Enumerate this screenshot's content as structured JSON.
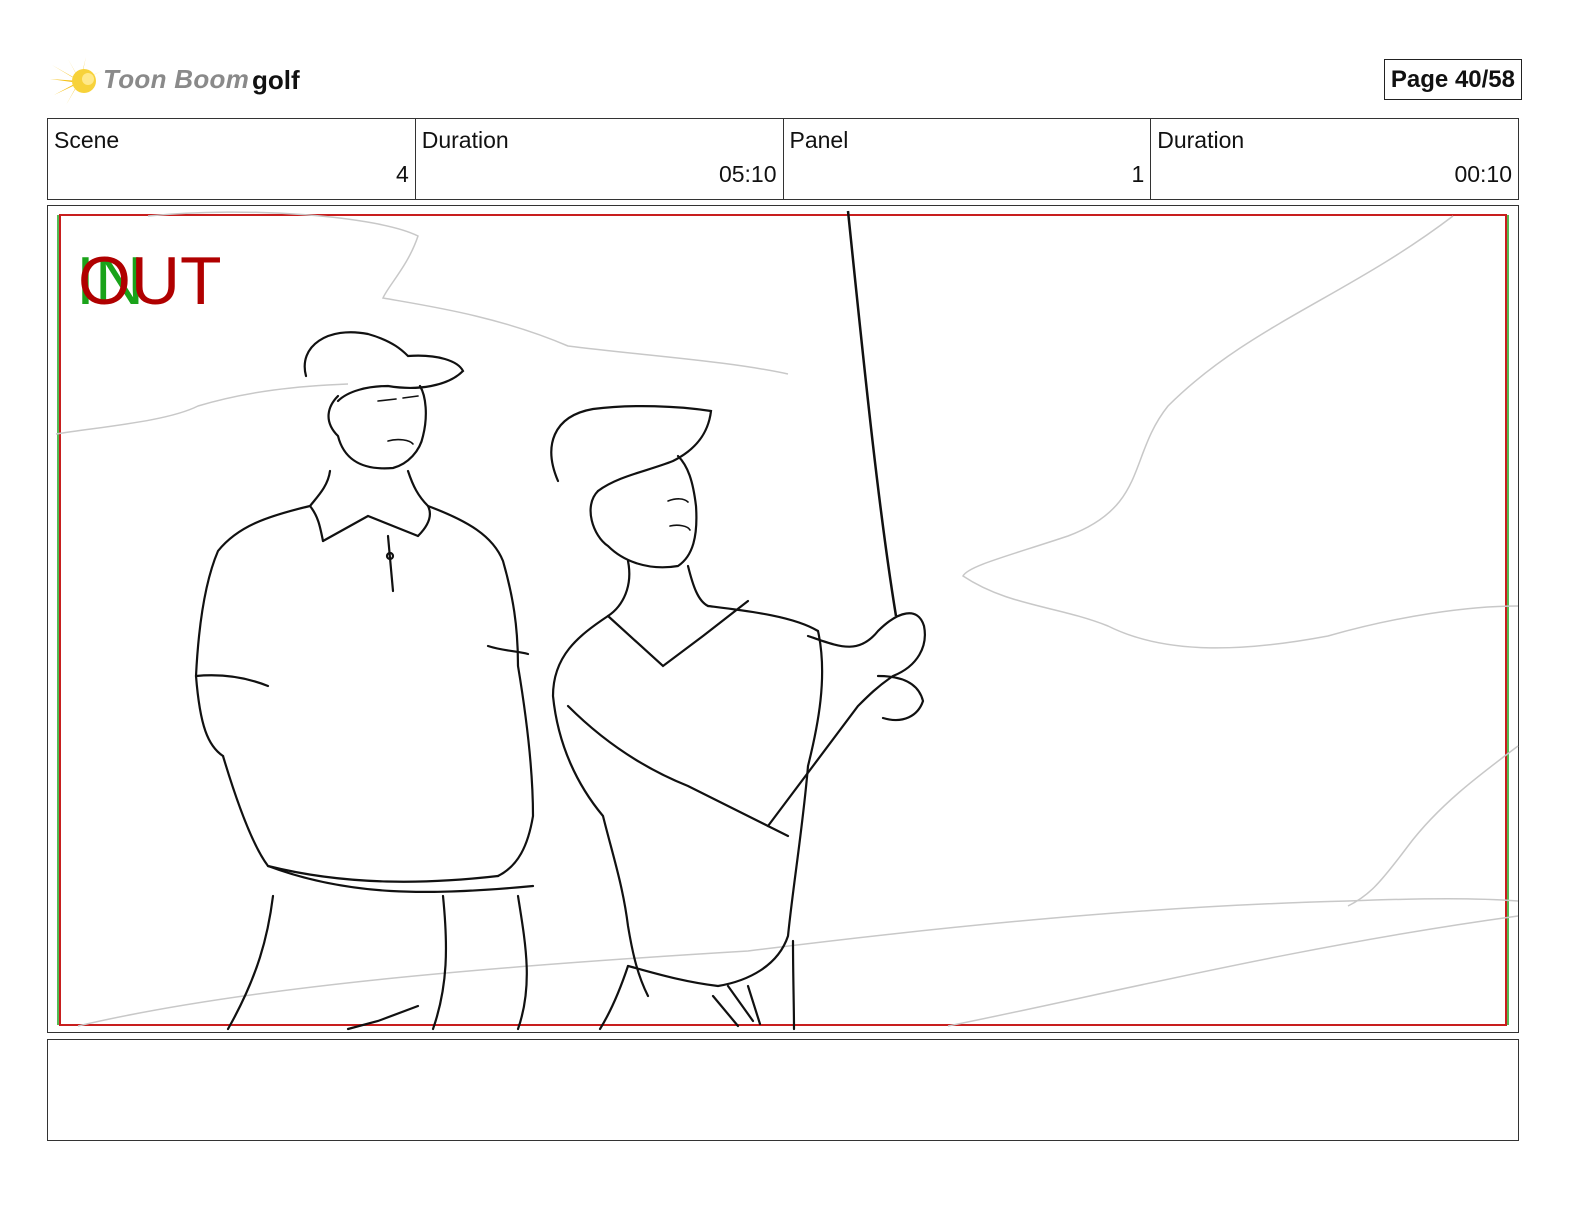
{
  "header": {
    "logo_text": "Toon Boom",
    "project_name": "golf",
    "page_label": "Page 40/58"
  },
  "info": {
    "scene_label": "Scene",
    "scene_value": "4",
    "scene_duration_label": "Duration",
    "scene_duration_value": "05:10",
    "panel_label": "Panel",
    "panel_value": "1",
    "panel_duration_label": "Duration",
    "panel_duration_value": "00:10"
  },
  "panel": {
    "in_marker": "IN",
    "out_marker": "OUT",
    "in_color": "#1aa31a",
    "out_color": "#b00000",
    "safe_frame_color": "#c81e1e"
  },
  "caption": {
    "text": ""
  }
}
